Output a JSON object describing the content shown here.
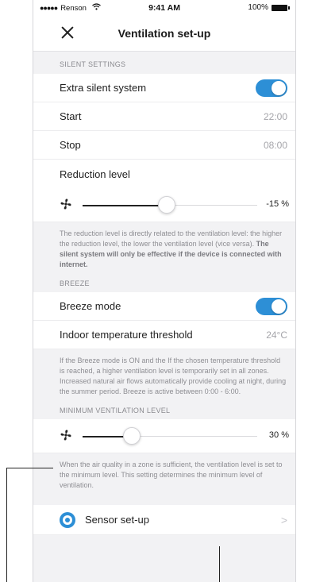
{
  "status": {
    "carrier": "Renson",
    "time": "9:41 AM",
    "battery": "100%"
  },
  "nav": {
    "title": "Ventilation set-up"
  },
  "silent": {
    "header": "SILENT SETTINGS",
    "extra_label": "Extra silent system",
    "extra_on": true,
    "start_label": "Start",
    "start_value": "22:00",
    "stop_label": "Stop",
    "stop_value": "08:00",
    "reduction_label": "Reduction level",
    "reduction_value": "-15 %",
    "reduction_level_fraction": 0.48,
    "note_plain": "The reduction level is directly related to the ventilation level: the higher the reduction level, the lower the ventilation level (vice versa). ",
    "note_bold": "The silent system will only be effective if the device is connected with internet."
  },
  "breeze": {
    "header": "BREEZE",
    "mode_label": "Breeze mode",
    "mode_on": true,
    "threshold_label": "Indoor temperature threshold",
    "threshold_value": "24°C",
    "note": "If the Breeze mode is ON and the If the chosen temperature threshold is reached, a higher ventilation level is temporarily set in all zones. Increased natural air flows automatically provide cooling at night, during the summer period. Breeze is active between 0:00 - 6:00."
  },
  "minimum": {
    "header": "MINIMUM VENTILATION LEVEL",
    "value": "30 %",
    "level_fraction": 0.28,
    "note": "When the air quality in a zone is sufficient, the ventilation level is set to the minimum level. This setting determines the minimum level of ventilation."
  },
  "sensor": {
    "label": "Sensor set-up",
    "chevron": ">"
  },
  "colors": {
    "accent": "#2d8fd6",
    "background": "#f2f2f4"
  }
}
